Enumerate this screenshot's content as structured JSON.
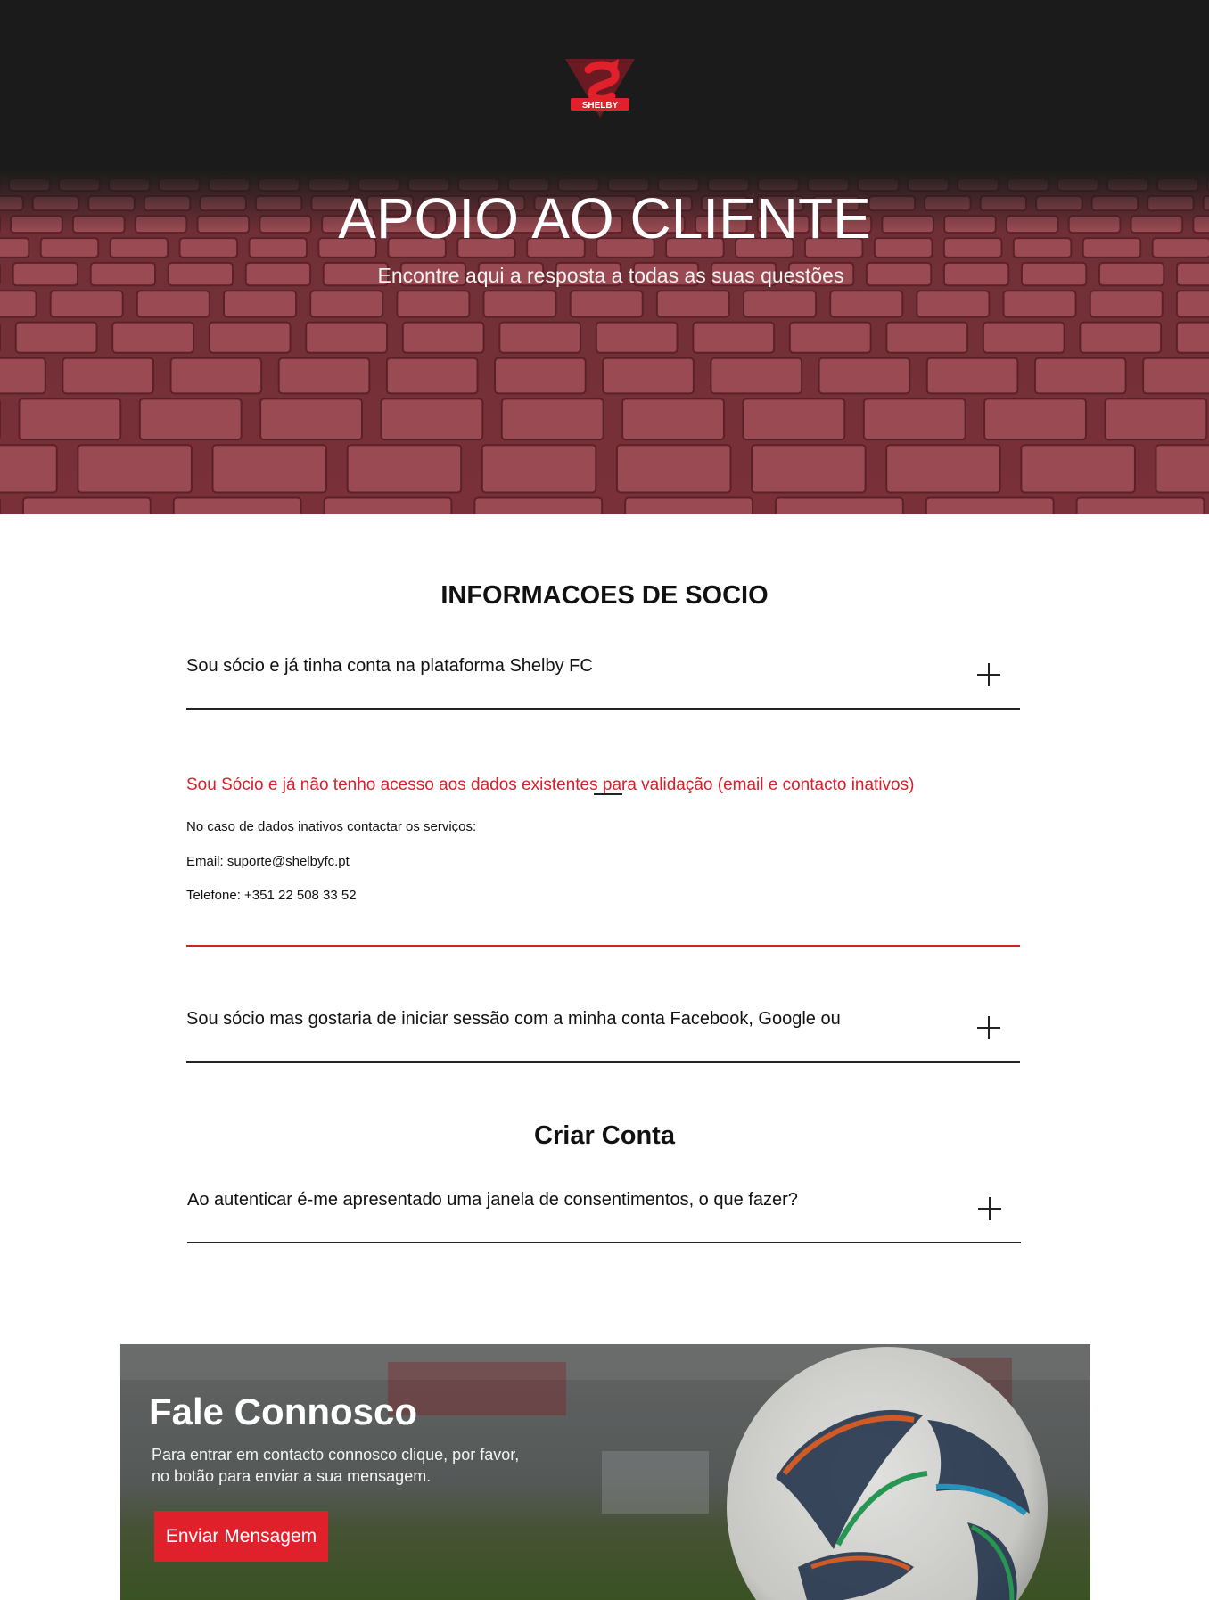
{
  "hero": {
    "logo_text": "SHELBY",
    "title": "APOIO AO CLIENTE",
    "subtitle": "Encontre aqui a resposta a todas as suas questões"
  },
  "sections": {
    "socio_title": "INFORMACOES DE SOCIO",
    "conta_title": "Criar Conta"
  },
  "faq": {
    "q1": "Sou sócio e já tinha conta na plataforma Shelby FC",
    "q2": "Sou Sócio e já não tenho acesso aos dados existentes para validação (email e contacto inativos)",
    "q2_answer": {
      "line1": "No caso de dados inativos contactar os serviços:",
      "line2": "Email: suporte@shelbyfc.pt",
      "line3": "Telefone: +351 22 508 33 52"
    },
    "q3": "Sou sócio mas gostaria de iniciar sessão com a minha conta Facebook, Google ou",
    "q4": "Ao autenticar é-me apresentado uma janela de consentimentos, o que fazer?"
  },
  "contact": {
    "title": "Fale Connosco",
    "text_line1": "Para entrar em contacto connosco clique, por favor,",
    "text_line2": "no botão para enviar a sua mensagem.",
    "button_label": "Enviar Mensagem"
  },
  "colors": {
    "accent": "#e0202b",
    "hero_dark": "#1b1b1b",
    "seat": "#8a3a42"
  }
}
